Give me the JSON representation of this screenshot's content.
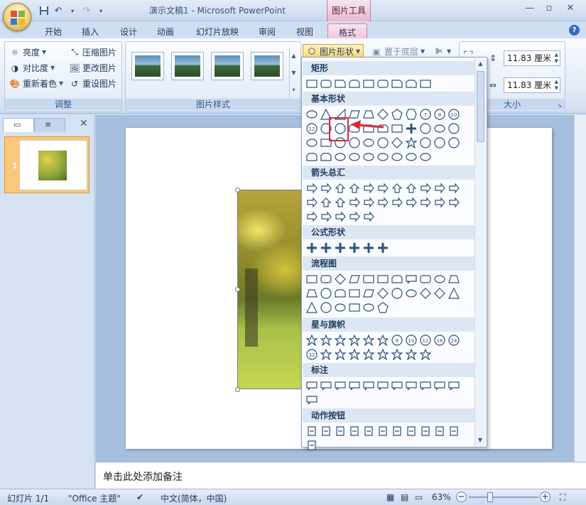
{
  "window": {
    "title": "演示文稿1 - Microsoft PowerPoint",
    "context_tool": "图片工具",
    "controls": [
      "minimize-icon",
      "restore-icon",
      "close-icon"
    ]
  },
  "quick_access": [
    "save-icon",
    "undo-icon",
    "redo-icon",
    "customize-icon"
  ],
  "tabs": [
    "开始",
    "插入",
    "设计",
    "动画",
    "幻灯片放映",
    "审阅",
    "视图",
    "格式"
  ],
  "active_tab": "格式",
  "ribbon": {
    "adjust": {
      "label": "调整",
      "items": [
        {
          "label": "亮度",
          "icon": "brightness-icon",
          "dropdown": true
        },
        {
          "label": "对比度",
          "icon": "contrast-icon",
          "dropdown": true
        },
        {
          "label": "重新着色",
          "icon": "recolor-icon",
          "dropdown": true
        },
        {
          "label": "压缩图片",
          "icon": "compress-icon"
        },
        {
          "label": "更改图片",
          "icon": "change-picture-icon"
        },
        {
          "label": "重设图片",
          "icon": "reset-picture-icon"
        }
      ]
    },
    "picture_styles": {
      "label": "图片样式",
      "thumb_count": 4
    },
    "picture_shape_button": "图片形状",
    "send_to_back": "置于底层",
    "size": {
      "label": "大小",
      "height": "11.83 厘米",
      "width": "11.83 厘米"
    }
  },
  "shapes_panel": {
    "sections": [
      {
        "title": "矩形",
        "count": 9
      },
      {
        "title": "基本形状",
        "count": 42,
        "numbered": [
          "7",
          "8",
          "10",
          "12"
        ]
      },
      {
        "title": "箭头总汇",
        "count": 27
      },
      {
        "title": "公式形状",
        "count": 6
      },
      {
        "title": "流程图",
        "count": 28
      },
      {
        "title": "星与旗帜",
        "count": 20,
        "numbered": [
          "8",
          "10",
          "12",
          "16",
          "24",
          "32"
        ]
      },
      {
        "title": "标注",
        "count": 12
      },
      {
        "title": "动作按钮",
        "count": 12
      }
    ],
    "highlighted": "基本形状 / 折角形"
  },
  "slides_panel": {
    "slide_number": "1"
  },
  "notes_placeholder": "单击此处添加备注",
  "status": {
    "slide": "幻灯片 1/1",
    "theme": "\"Office 主题\"",
    "language": "中文(简体，中国)",
    "zoom": "63%"
  },
  "colors": {
    "accent": "#e3262b",
    "ribbon_bg": "#dfe9f6",
    "context_tab": "#f2c6d9"
  }
}
